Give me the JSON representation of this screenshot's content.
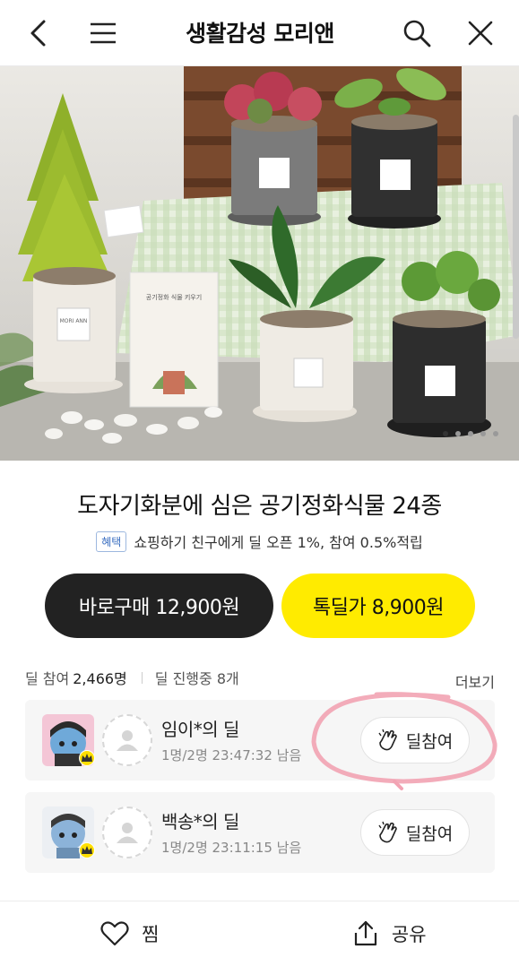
{
  "header": {
    "title": "생활감성 모리앤",
    "back_icon": "chevron-left-icon",
    "menu_icon": "hamburger-icon",
    "search_icon": "search-icon",
    "close_icon": "close-icon"
  },
  "hero": {
    "pot_label": "MORI ANN",
    "booklet_title": "공기정화 식물 키우기"
  },
  "product": {
    "title": "도자기화분에 심은 공기정화식물 24종",
    "benefit_badge": "혜택",
    "benefit_text": "쇼핑하기 친구에게 딜 오픈 1%, 참여 0.5%적립"
  },
  "buttons": {
    "direct_buy": "바로구매 12,900원",
    "deal_price": "톡딜가 8,900원"
  },
  "deal_stats": {
    "participants_label": "딜 참여",
    "participants_count": "2,466명",
    "ongoing": "딜 진행중 8개",
    "more": "더보기"
  },
  "deals": [
    {
      "name": "임이*의 딜",
      "meta": "1명/2명  23:47:32 남음",
      "join": "딜참여"
    },
    {
      "name": "백송*의 딜",
      "meta": "1명/2명  23:11:15 남음",
      "join": "딜참여"
    }
  ],
  "bottom_bar": {
    "wish": "찜",
    "share": "공유"
  },
  "colors": {
    "deal_yellow": "#ffeb00",
    "dark_button": "#222222",
    "badge_blue": "#3b6fc1",
    "annotation_pink": "#f2a3b3"
  }
}
